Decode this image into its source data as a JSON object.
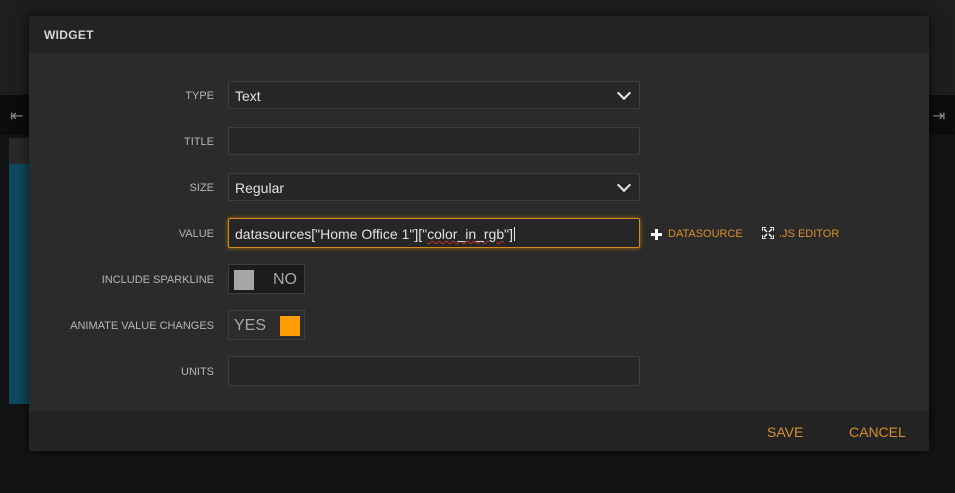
{
  "dialog": {
    "title": "WIDGET",
    "fields": {
      "type": {
        "label": "TYPE",
        "value": "Text"
      },
      "title": {
        "label": "TITLE",
        "value": ""
      },
      "size": {
        "label": "SIZE",
        "value": "Regular"
      },
      "value": {
        "label": "VALUE",
        "value_prefix": "datasources[\"Home Office 1\"][\"",
        "value_underlined": "color_in_rgb",
        "value_suffix": "\"]",
        "datasource_link": "DATASOURCE",
        "js_editor_link": ".JS EDITOR"
      },
      "include_sparkline": {
        "label": "INCLUDE SPARKLINE",
        "state": "NO"
      },
      "animate_value_changes": {
        "label": "ANIMATE VALUE CHANGES",
        "state": "YES"
      },
      "units": {
        "label": "UNITS",
        "value": ""
      }
    },
    "footer": {
      "save_label": "SAVE",
      "cancel_label": "CANCEL"
    }
  },
  "colors": {
    "accent": "#d98f2a",
    "toggle_on": "#ff9c00",
    "toggle_off": "#a6a6a6",
    "focus_border": "#d58b1c"
  },
  "icons": {
    "datasource_add": "plus-icon",
    "js_editor": "expand-icon",
    "select_arrow": "chevron-down-icon"
  }
}
